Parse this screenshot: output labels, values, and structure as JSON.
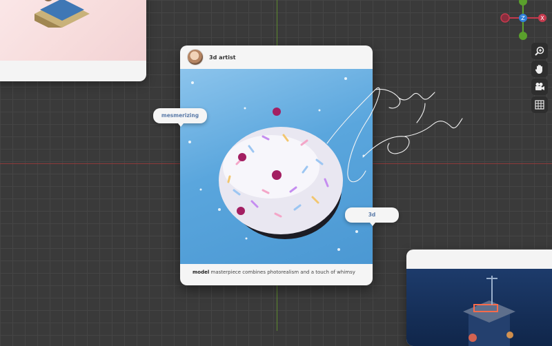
{
  "card": {
    "username": "3d artist",
    "caption_bold": "model",
    "caption_text": "masterpiece combines photorealism and a touch of whimsy"
  },
  "tags": {
    "left": "mesmerizing",
    "right": "3d"
  },
  "gizmo": {
    "z_label": "Z",
    "x_label": "X"
  },
  "colors": {
    "grid_bg": "#3a3a3a",
    "axis_x": "#8e3a3a",
    "axis_y": "#5d8a2e",
    "tag_text": "#5a7aa8"
  },
  "toolbar": {
    "icons": [
      "zoom-icon",
      "pan-hand-icon",
      "camera-icon",
      "grid-icon"
    ]
  }
}
